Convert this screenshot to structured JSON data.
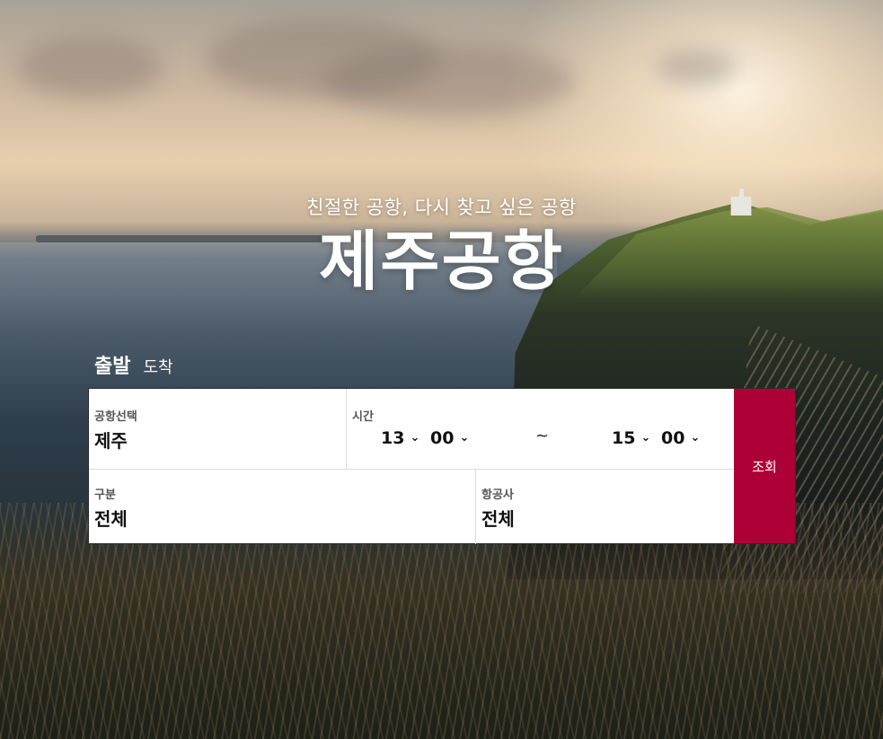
{
  "hero": {
    "subtitle": "친절한 공항, 다시 찾고 싶은 공항",
    "title": "제주공항"
  },
  "tabs": [
    {
      "label": "출발",
      "active": true
    },
    {
      "label": "도착",
      "active": false
    }
  ],
  "form": {
    "airport": {
      "label": "공항선택",
      "value": "제주"
    },
    "time": {
      "label": "시간",
      "from_hour": "13",
      "from_minute": "00",
      "separator": "~",
      "to_hour": "15",
      "to_minute": "00"
    },
    "type": {
      "label": "구분",
      "value": "전체"
    },
    "airline": {
      "label": "항공사",
      "value": "전체"
    },
    "search_label": "조회"
  },
  "colors": {
    "accent": "#ad0037"
  },
  "icons": {
    "dropdown": "chevron-down-icon"
  }
}
